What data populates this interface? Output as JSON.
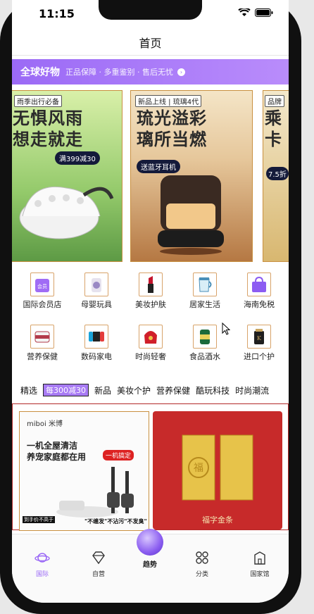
{
  "status": {
    "time": "11:15"
  },
  "nav": {
    "title": "首页"
  },
  "banner": {
    "title": "全球好物",
    "subtitle": "正品保障 · 多重鉴别 · 售后无忧"
  },
  "cards": [
    {
      "tag": "雨季出行必备",
      "headline_1": "无惧风雨",
      "headline_2": "想走就走",
      "badge": "满399减30"
    },
    {
      "tag": "新品上线 | 琉璃4代",
      "headline_1": "琉光溢彩",
      "headline_2": "璃所当燃",
      "badge": "送蓝牙耳机"
    },
    {
      "tag": "品牌",
      "headline_1": "乘",
      "headline_2": "卡",
      "badge": "7.5折"
    }
  ],
  "categories": [
    {
      "label": "国际会员店",
      "icon": "member-icon"
    },
    {
      "label": "母婴玩具",
      "icon": "baby-formula-icon"
    },
    {
      "label": "美妆护肤",
      "icon": "lipstick-icon"
    },
    {
      "label": "居家生活",
      "icon": "water-pitcher-icon"
    },
    {
      "label": "海南免税",
      "icon": "shopping-bag-icon"
    },
    {
      "label": "营养保健",
      "icon": "supplement-icon"
    },
    {
      "label": "数码家电",
      "icon": "game-console-icon"
    },
    {
      "label": "时尚轻奢",
      "icon": "handbag-icon"
    },
    {
      "label": "食品酒水",
      "icon": "beverage-icon"
    },
    {
      "label": "进口个护",
      "icon": "hair-care-icon"
    }
  ],
  "tabs": [
    "精选",
    "每300减30",
    "新品",
    "美妆个护",
    "营养保健",
    "酷玩科技",
    "时尚潮流"
  ],
  "products": [
    {
      "brand": "miboi 米博",
      "line_1": "一机全屋清洁",
      "line_2": "养宠家庭都在用",
      "tag": "一机搞定",
      "promo_a": "到手价不高于",
      "promo_b": "\"不缠发\"不沾污\"不发臭\""
    },
    {
      "caption": "福字金条"
    }
  ],
  "tabbar": [
    {
      "label": "国际",
      "icon": "planet-icon"
    },
    {
      "label": "自营",
      "icon": "diamond-icon"
    },
    {
      "label": "趋势",
      "icon": "trend-orb-icon"
    },
    {
      "label": "分类",
      "icon": "grid-icon"
    },
    {
      "label": "国家馆",
      "icon": "pavilion-icon"
    }
  ],
  "colors": {
    "accent": "#9b6af6",
    "gold_border": "#c99040",
    "red": "#c72a2a"
  }
}
